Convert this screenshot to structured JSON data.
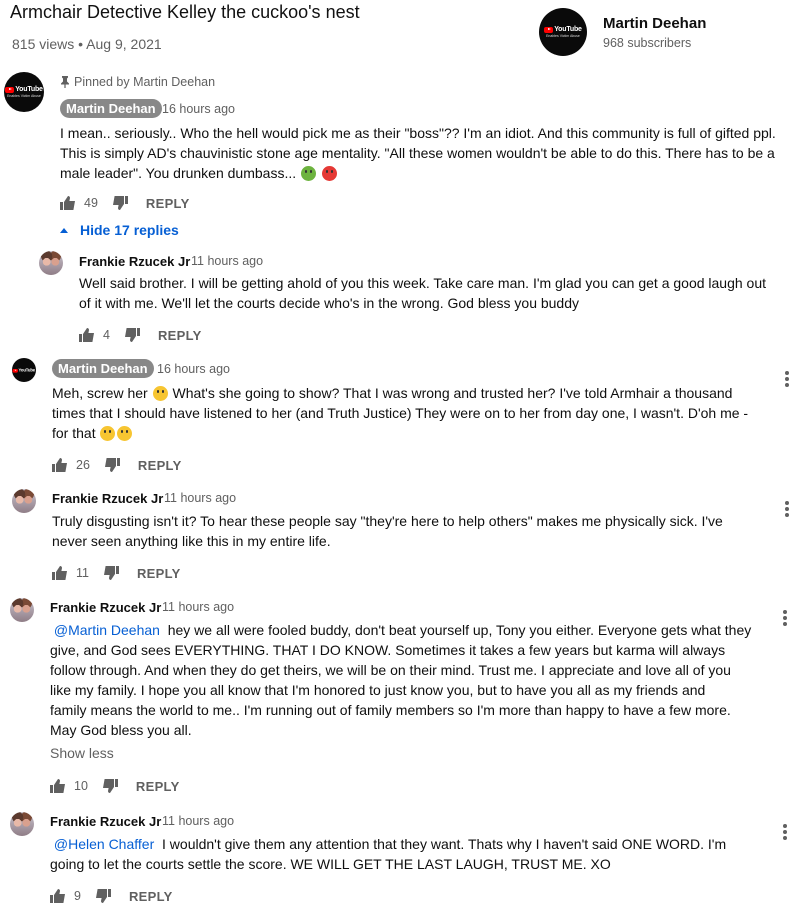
{
  "video": {
    "title": "Armchair Detective Kelley the cuckoo's nest",
    "meta": "815 views • Aug 9, 2021"
  },
  "channel": {
    "name": "Martin Deehan",
    "subscribers": "968 subscribers",
    "avatar_logo": "YouTube",
    "avatar_tagline": "Enables Victim Abuse"
  },
  "comments": [
    {
      "pinned_label": "Pinned by Martin Deehan",
      "author": "Martin Deehan",
      "time": "16 hours ago",
      "lines": [
        "I mean.. seriously.. Who the hell would pick me as their \"boss\"?? I'm an idiot. And this community is full of gifted ppl.",
        "This is simply AD's chauvinistic stone age mentality. \"All these women wouldn't be able to do this. There has to be a",
        "male leader\". You drunken dumbass..."
      ],
      "likes": "49",
      "reply_label": "REPLY",
      "hide_replies": "Hide 17 replies"
    },
    {
      "author": "Frankie Rzucek Jr",
      "time": "11 hours ago",
      "lines": [
        "Well said brother. I will be getting ahold of you this week. Take care man. I'm glad you can get a good laugh out",
        "of it with me. We'll let the courts decide who's in the wrong. God bless you buddy"
      ],
      "likes": "4",
      "reply_label": "REPLY"
    },
    {
      "author": "Martin Deehan",
      "time": "16 hours ago",
      "line1a": "Meh, screw her",
      "line1b": "What's  she going to show? That I was wrong and trusted her? I've told Armhair a thousand",
      "line2": "times that I should have listened to her (and Truth Justice) They were on to her from day one, I wasn't. D'oh me -",
      "line3": "for that",
      "likes": "26",
      "reply_label": "REPLY"
    },
    {
      "author": "Frankie Rzucek Jr",
      "time": "11 hours ago",
      "lines": [
        "Truly disgusting isn't it? To hear these people say \"they're here to help others\" makes me physically sick. I've",
        "never seen anything like this in my entire life."
      ],
      "likes": "11",
      "reply_label": "REPLY"
    },
    {
      "author": "Frankie Rzucek Jr",
      "time": "11 hours ago",
      "mention": "@Martin Deehan",
      "first_line": "hey we all were fooled buddy, don't beat yourself up, Tony you either. Everyone gets what they",
      "lines": [
        "give, and God sees EVERYTHING. THAT I DO KNOW. Sometimes it takes a few years but karma will always",
        "follow through. And when they do get theirs, we will be on their mind. Trust me. I appreciate and love all of you",
        "like my family. I hope you all know that I'm honored to just know you, but to have you all as my friends and",
        "family means the world to me.. I'm running out of family members so I'm more than happy to have a few more.",
        "May God bless you all."
      ],
      "show_less": "Show less",
      "likes": "10",
      "reply_label": "REPLY"
    },
    {
      "author": "Frankie Rzucek Jr",
      "time": "11 hours ago",
      "mention": "@Helen Chaffer",
      "first_line": "I wouldn't give them any attention that they want. Thats why I haven't said ONE WORD. I'm",
      "lines": [
        "going to let the courts settle the score. WE WILL GET THE LAST LAUGH, TRUST ME. XO"
      ],
      "likes": "9",
      "reply_label": "REPLY"
    }
  ]
}
